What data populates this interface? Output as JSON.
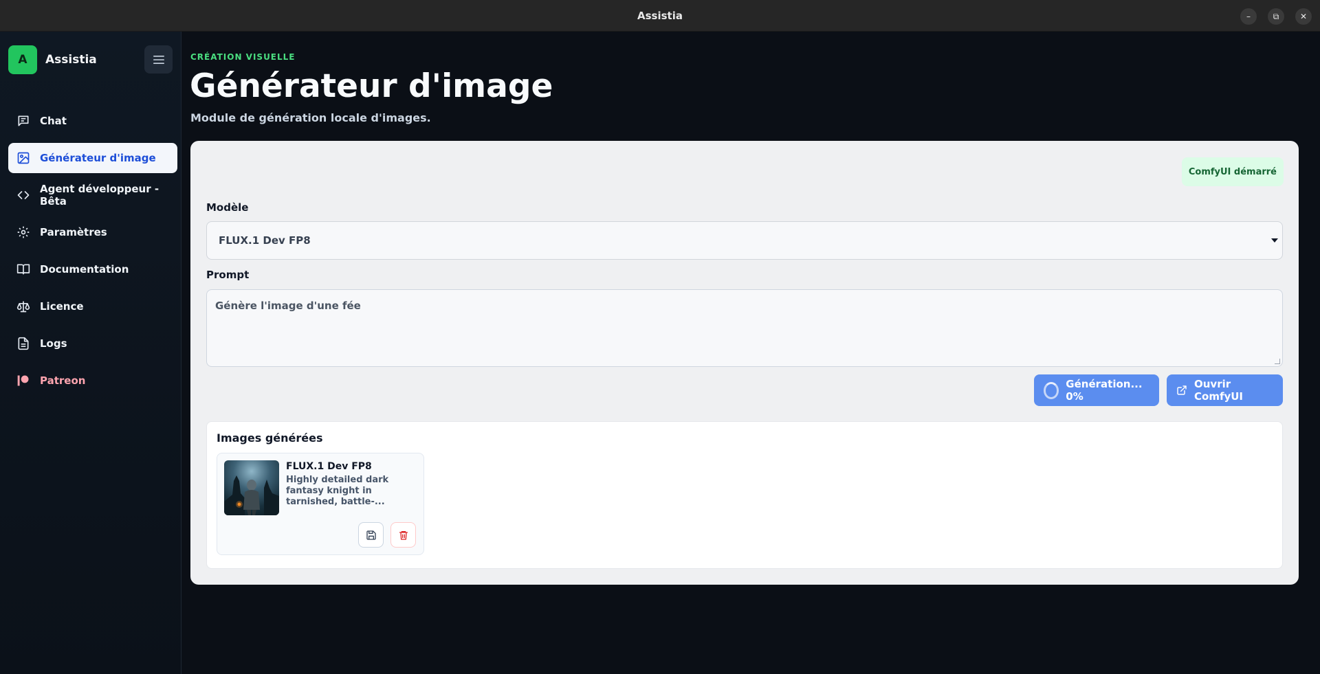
{
  "window": {
    "title": "Assistia",
    "controls": [
      "–",
      "⧉",
      "✕"
    ]
  },
  "sidebar": {
    "avatar_letter": "A",
    "brand": "Assistia",
    "items": [
      {
        "label": "Chat",
        "icon": "chat-icon"
      },
      {
        "label": "Générateur d'image",
        "icon": "image-icon",
        "active": true
      },
      {
        "label": "Agent développeur - Bêta",
        "icon": "code-icon"
      },
      {
        "label": "Paramètres",
        "icon": "gear-icon"
      },
      {
        "label": "Documentation",
        "icon": "book-icon"
      },
      {
        "label": "Licence",
        "icon": "scale-icon"
      },
      {
        "label": "Logs",
        "icon": "file-icon"
      },
      {
        "label": "Patreon",
        "icon": "patreon-icon"
      }
    ]
  },
  "header": {
    "eyebrow": "CRÉATION VISUELLE",
    "title": "Générateur d'image",
    "subtitle": "Module de génération locale d'images."
  },
  "status": {
    "label": "ComfyUI démarré"
  },
  "model": {
    "label": "Modèle",
    "selected": "FLUX.1 Dev FP8"
  },
  "prompt": {
    "label": "Prompt",
    "value": "Génère l'image d'une fée"
  },
  "actions": {
    "generate_label": "Génération... 0%",
    "generate_progress": 0,
    "open_label": "Ouvrir ComfyUI"
  },
  "gallery": {
    "title": "Images générées",
    "items": [
      {
        "model": "FLUX.1 Dev FP8",
        "description": "Highly detailed dark fantasy knight in tarnished, battle-..."
      }
    ]
  },
  "colors": {
    "accent": "#5b8def",
    "active_nav_text": "#1d4ed8",
    "eyebrow": "#4ade80",
    "avatar": "#22c55e",
    "status_bg": "#dcfce7",
    "danger": "#dc2626"
  }
}
